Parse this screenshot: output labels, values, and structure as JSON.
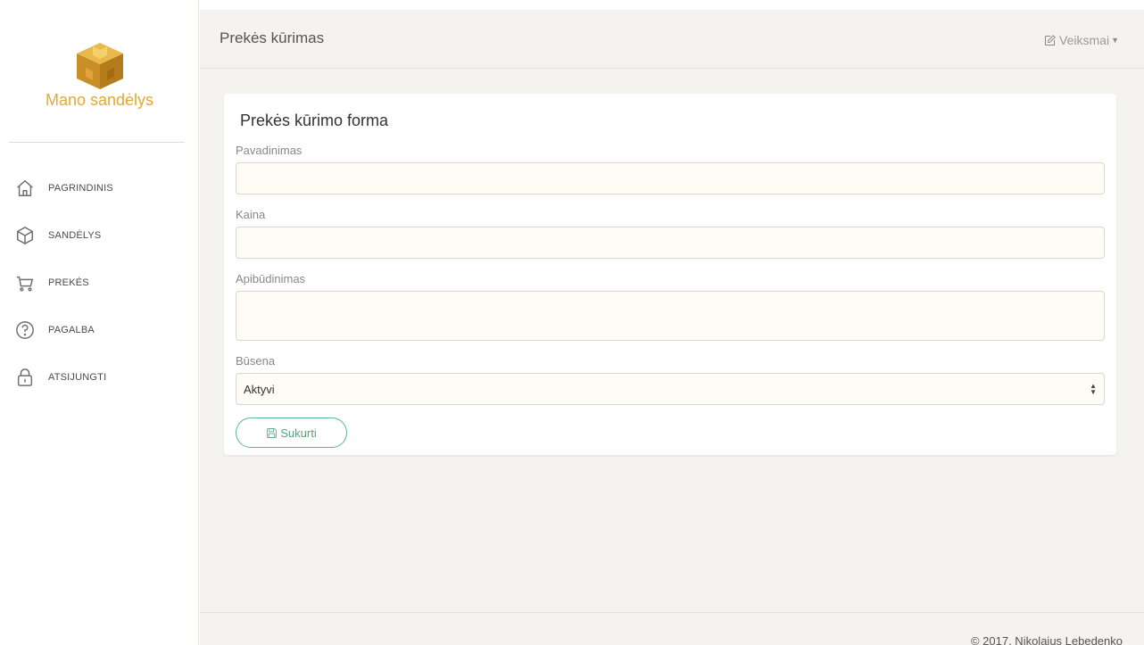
{
  "brand": {
    "name": "Mano sandėlys",
    "logo_icon": "box-logo-icon",
    "color": "#e2a935"
  },
  "sidebar": {
    "items": [
      {
        "label": "PAGRINDINIS",
        "icon": "home-icon"
      },
      {
        "label": "SANDĖLYS",
        "icon": "cube-icon"
      },
      {
        "label": "PREKĖS",
        "icon": "cart-icon"
      },
      {
        "label": "PAGALBA",
        "icon": "help-circle-icon"
      },
      {
        "label": "ATSIJUNGTI",
        "icon": "lock-icon"
      }
    ]
  },
  "header": {
    "title": "Prekės kūrimas",
    "actions_label": "Veiksmai",
    "actions_icon": "edit-icon"
  },
  "form": {
    "title": "Prekės kūrimo forma",
    "fields": {
      "name_label": "Pavadinimas",
      "name_value": "",
      "price_label": "Kaina",
      "price_value": "",
      "description_label": "Apibūdinimas",
      "description_value": "",
      "status_label": "Būsena",
      "status_value": "Aktyvi"
    },
    "submit_label": "Sukurti",
    "submit_icon": "save-icon",
    "accent_color": "#4aa97a"
  },
  "footer": {
    "text": "© 2017, Nikolajus Lebedenko"
  }
}
